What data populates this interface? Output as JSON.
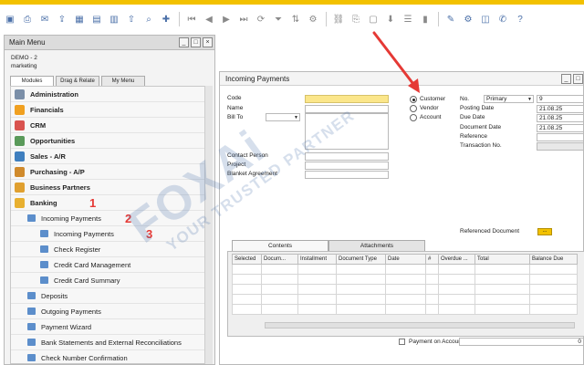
{
  "colors": {
    "accent": "#f2c100",
    "arrow": "#e53935",
    "folder_icon": "#5c8ecb"
  },
  "toolbar": {
    "icons": [
      "folder-icon",
      "print-icon",
      "email-icon",
      "export-icon",
      "excel-icon",
      "word-icon",
      "pdf-icon",
      "up-icon",
      "find-icon",
      "add-icon",
      "first-icon",
      "prev-icon",
      "next-icon",
      "last-icon",
      "refresh-icon",
      "filter-icon",
      "sort-icon",
      "settings-icon",
      "link-icon",
      "copy-icon",
      "new-icon",
      "drill-icon",
      "report-icon",
      "chart-icon",
      "edit-icon",
      "settings-icon",
      "preview-icon",
      "chat-icon",
      "help-icon"
    ]
  },
  "main_menu": {
    "title": "Main Menu",
    "company": "DEMO - 2",
    "user": "marketing",
    "tabs": [
      "Modules",
      "Drag & Relate",
      "My Menu"
    ],
    "modules": [
      {
        "label": "Administration",
        "icon": "administration-icon",
        "color": "#7b8fa8"
      },
      {
        "label": "Financials",
        "icon": "financials-icon",
        "color": "#f0a020"
      },
      {
        "label": "CRM",
        "icon": "crm-icon",
        "color": "#d9534f"
      },
      {
        "label": "Opportunities",
        "icon": "opportunities-icon",
        "color": "#5a9a5a"
      },
      {
        "label": "Sales - A/R",
        "icon": "sales-icon",
        "color": "#3f7fbf"
      },
      {
        "label": "Purchasing - A/P",
        "icon": "purchasing-icon",
        "color": "#d08a2c"
      },
      {
        "label": "Business Partners",
        "icon": "business-partners-icon",
        "color": "#e0a030"
      },
      {
        "label": "Banking",
        "icon": "banking-icon",
        "color": "#e8b030"
      }
    ],
    "banking_children": {
      "incoming_folder": "Incoming Payments",
      "incoming_items": [
        "Incoming Payments",
        "Check Register",
        "Credit Card Management",
        "Credit Card Summary"
      ],
      "other_items": [
        "Deposits",
        "Outgoing Payments",
        "Payment Wizard",
        "Bank Statements and External Reconciliations",
        "Check Number Confirmation"
      ]
    },
    "annotations": [
      "1",
      "2",
      "3"
    ]
  },
  "payment_window": {
    "title": "Incoming Payments",
    "left_fields": [
      "Code",
      "Name",
      "Bill To",
      "Contact Person",
      "Project",
      "Blanket Agreement"
    ],
    "radio_options": [
      {
        "label": "Customer",
        "selected": true
      },
      {
        "label": "Vendor",
        "selected": false
      },
      {
        "label": "Account",
        "selected": false
      }
    ],
    "right_fields": {
      "no_label": "No.",
      "series": "Primary",
      "number": "9",
      "posting_date_label": "Posting Date",
      "posting_date": "21.08.25",
      "due_date_label": "Due Date",
      "due_date": "21.08.25",
      "document_date_label": "Document Date",
      "document_date": "21.08.25",
      "reference_label": "Reference",
      "transaction_label": "Transaction No."
    },
    "referenced_document_label": "Referenced Document",
    "referenced_document_button": "...",
    "tabs": [
      "Contents",
      "Attachments"
    ],
    "grid_columns": [
      "Selected",
      "Docum...",
      "Installment",
      "Document Type",
      "Date",
      "#",
      "Overdue ...",
      "Total",
      "Balance Due"
    ],
    "payment_on_account_label": "Payment on Account",
    "payment_on_account_value": "0"
  },
  "watermark": {
    "brand": "FOXAi",
    "tagline": "YOUR TRUSTED PARTNER"
  }
}
